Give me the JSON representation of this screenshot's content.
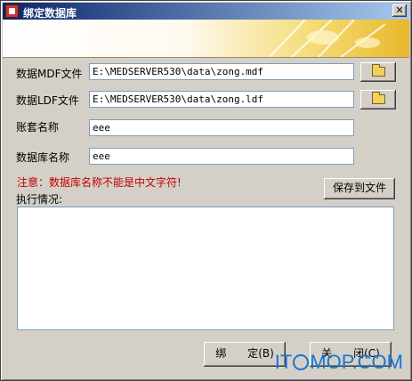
{
  "window": {
    "title": "绑定数据库",
    "close_glyph": "✕",
    "accent_color": "#0a246a"
  },
  "form": {
    "mdf_label": "数据MDF文件",
    "mdf_value": "E:\\MEDSERVER530\\data\\zong.mdf",
    "ldf_label": "数据LDF文件",
    "ldf_value": "E:\\MEDSERVER530\\data\\zong.ldf",
    "account_label": "账套名称",
    "account_value": "eee",
    "dbname_label": "数据库名称",
    "dbname_value": "eee",
    "browse_icon": "folder-icon"
  },
  "warning": {
    "text": "注意：数据库名称不能是中文字符!",
    "color": "#c00000"
  },
  "save_button": "保存到文件",
  "log": {
    "label": "执行情况:",
    "content": ""
  },
  "footer": {
    "bind_button": "绑　　定(B)",
    "close_button": "关　　闭(C)"
  },
  "watermark": {
    "text_left": "IT",
    "text_right": "MOP.COM"
  }
}
